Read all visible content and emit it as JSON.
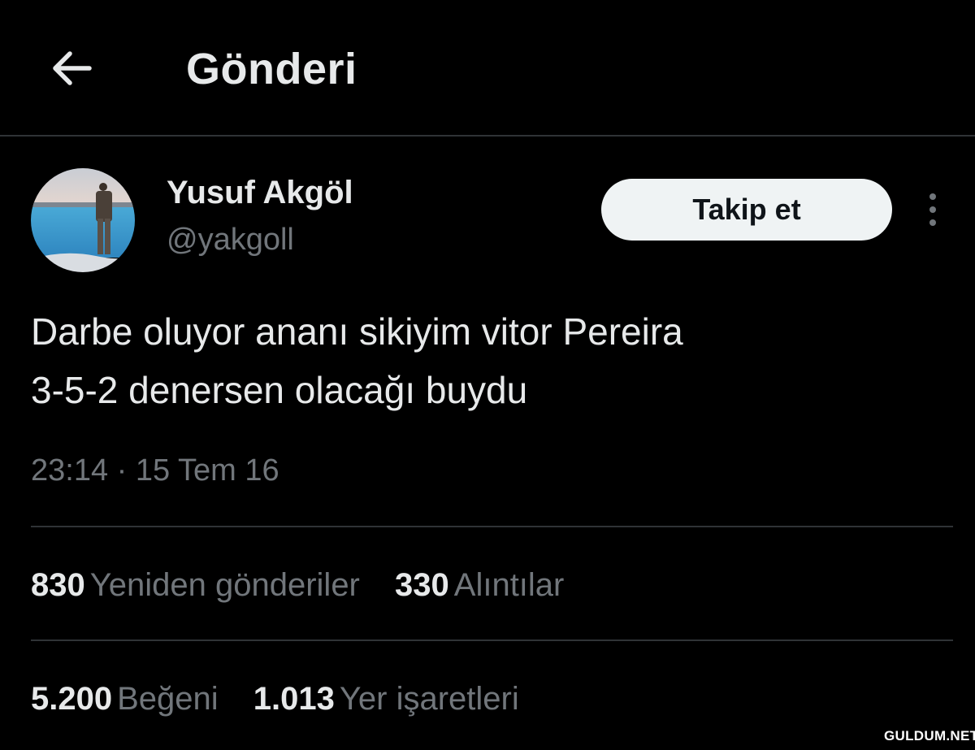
{
  "header": {
    "title": "Gönderi",
    "back_icon": "arrow-left-icon"
  },
  "tweet": {
    "author": {
      "display_name": "Yusuf Akgöl",
      "handle": "@yakgoll"
    },
    "follow_label": "Takip et",
    "more_icon": "more-vertical-icon",
    "text_lines": [
      "Darbe oluyor ananı sikiyim vitor Pereira",
      "3-5-2 denersen olacağı buydu"
    ],
    "timestamp": "23:14 · 15 Tem 16",
    "stats": {
      "retweets": {
        "count": "830",
        "label": "Yeniden gönderiler"
      },
      "quotes": {
        "count": "330",
        "label": "Alıntılar"
      },
      "likes": {
        "count": "5.200",
        "label": "Beğeni"
      },
      "bookmarks": {
        "count": "1.013",
        "label": "Yer işaretleri"
      }
    }
  },
  "watermark": "GULDUM.NET",
  "colors": {
    "background": "#000000",
    "text_primary": "#e7e9ea",
    "text_secondary": "#71767b",
    "divider": "#2f3336",
    "follow_button_bg": "#eff3f4"
  }
}
